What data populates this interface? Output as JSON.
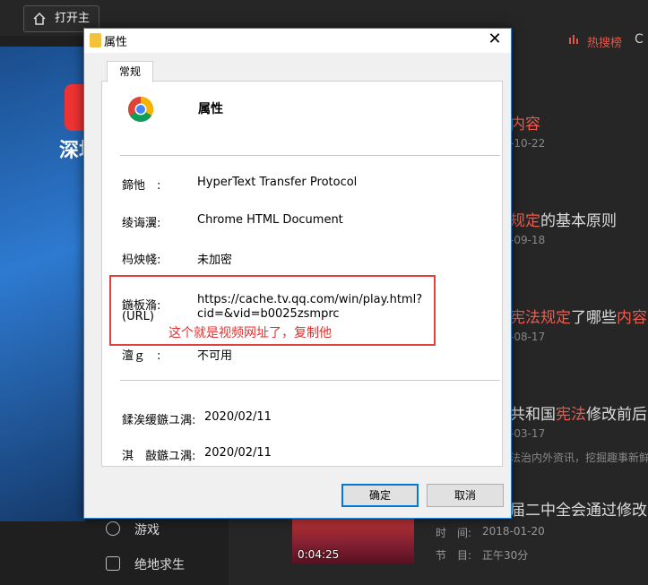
{
  "background": {
    "open_button": "打开主",
    "hot_tab": "热搜榜",
    "logo_text": "深圳",
    "left_items": [
      {
        "label": "游戏"
      },
      {
        "label": "绝地求生"
      }
    ],
    "results": [
      {
        "pre": "",
        "hl": "内容",
        "post": "",
        "date": "-10-22"
      },
      {
        "pre": "",
        "hl": "规定",
        "post": "的基本原则",
        "date": "-09-18"
      },
      {
        "pre": "",
        "hl": "宪法规定",
        "post": "了哪些",
        "hl2": "内容",
        "post2": "?",
        "date": "-08-17"
      },
      {
        "pre": "共和国",
        "hl": "宪法",
        "post": "修改前后",
        "date": "-03-17",
        "desc": "法治内外资讯，挖掘趣事新鲜事"
      },
      {
        "pre": "届二中全会通过修改",
        "hl": "",
        "post": "",
        "date": ""
      }
    ],
    "thumb_duration": "0:04:25",
    "meta_time_label": "时　间:",
    "meta_time": "2018-01-20",
    "meta_section_label": "节　目:",
    "meta_section": "正午30分"
  },
  "dialog": {
    "title": "属性",
    "close": "✕",
    "tab": "常规",
    "header": "属性",
    "rows": [
      {
        "label": "鍗忚　:",
        "value": "HyperText Transfer Protocol"
      },
      {
        "label": "绫诲瀷:",
        "value": "Chrome HTML Document"
      },
      {
        "label": "杩炴帴:",
        "value": "未加密"
      },
      {
        "label": "鍦板潃:",
        "label2": "(URL)",
        "value": "https://cache.tv.qq.com/win/play.html?",
        "value2": "cid=&vid=b0025zsmprc"
      },
      {
        "label": "澶ｇ　:",
        "value": "不可用"
      },
      {
        "label": "鍒涘缓鏃ユ湡:",
        "value": "2020/02/11"
      },
      {
        "label": "淇　敼鏃ユ湡:",
        "value": "2020/02/11"
      }
    ],
    "annotation": "这个就是视频网址了，复制他",
    "ok": "确定",
    "cancel": "取消"
  }
}
